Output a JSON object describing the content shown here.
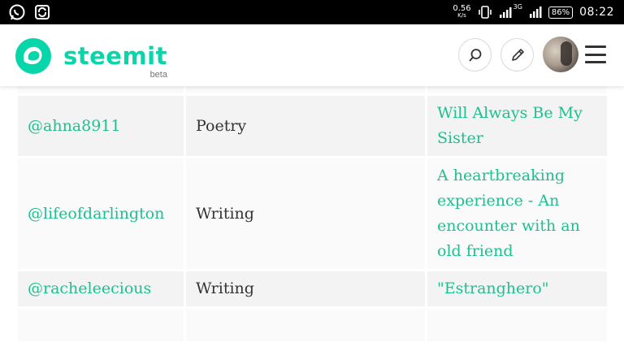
{
  "status_bar": {
    "speed_value": "0.56",
    "speed_unit": "K/s",
    "network": "3G",
    "battery": "86%",
    "time": "08:22"
  },
  "header": {
    "brand": "steemit",
    "beta": "beta",
    "colors": {
      "brand": "#06d6a9",
      "link": "#1fbf8f"
    },
    "icons": [
      "search-icon",
      "pencil-icon",
      "avatar",
      "hamburger-menu-icon"
    ]
  },
  "table": {
    "rows": [
      {
        "user": "",
        "category": "",
        "title": "",
        "partial": true
      },
      {
        "user": "@ahna8911",
        "category": "Poetry",
        "title": "Will Always Be My Sister"
      },
      {
        "user": "@lifeofdarlington",
        "category": "Writing",
        "title": "A heartbreaking experience - An encounter with an old friend"
      },
      {
        "user": "@racheleecious",
        "category": "Writing",
        "title": "\"Estranghero\""
      },
      {
        "user": "",
        "category": "",
        "title": "",
        "partial": true
      }
    ]
  }
}
